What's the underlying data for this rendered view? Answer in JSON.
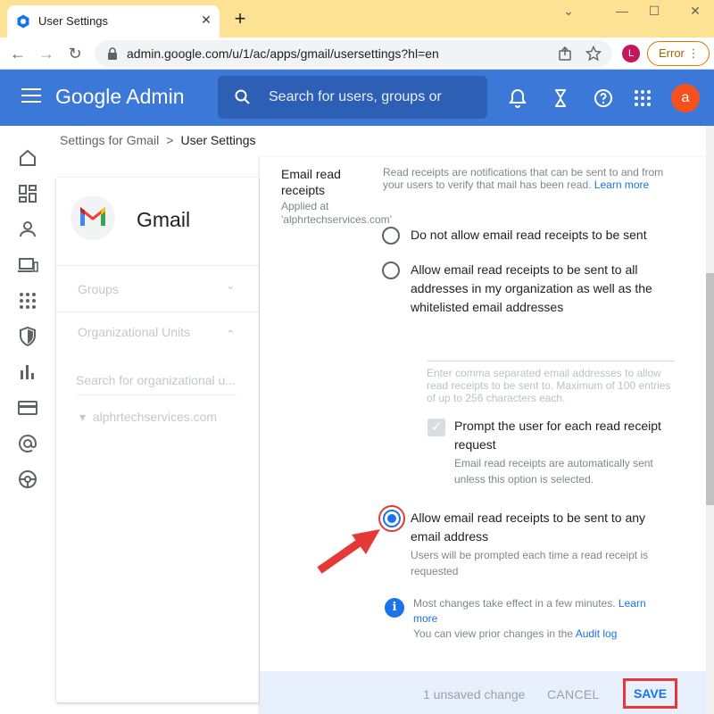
{
  "browser": {
    "tab_title": "User Settings",
    "tab_close": "✕",
    "new_tab": "+",
    "url": "admin.google.com/u/1/ac/apps/gmail/usersettings?hl=en",
    "profile_initial": "L",
    "error_label": "Error",
    "controls": {
      "minimize": "—",
      "maximize": "☐",
      "close": "✕"
    }
  },
  "header": {
    "brand": "Google Admin",
    "search_placeholder": "Search for users, groups or",
    "avatar_initial": "a"
  },
  "breadcrumb": {
    "parent": "Settings for Gmail",
    "separator": ">",
    "current": "User Settings"
  },
  "left_card": {
    "app_name": "Gmail",
    "groups_label": "Groups",
    "org_units_label": "Organizational Units",
    "ou_search_placeholder": "Search for organizational u...",
    "ou_item": "alphrtechservices.com",
    "chev_down": "⌄",
    "chev_up": "⌃",
    "caret": "▾"
  },
  "setting": {
    "title": "Email read receipts",
    "applied_at": "Applied at 'alphrtechservices.com'",
    "description": "Read receipts are notifications that can be sent to and from your users to verify that mail has been read.",
    "learn_more": "Learn more",
    "options": [
      {
        "label": "Do not allow email read receipts to be sent",
        "selected": false
      },
      {
        "label": "Allow email read receipts to be sent to all addresses in my organization as well as the whitelisted email addresses",
        "selected": false
      },
      {
        "label": "Allow email read receipts to be sent to any email address",
        "selected": true,
        "sub": "Users will be prompted each time a read receipt is requested"
      }
    ],
    "whitelist_placeholder": "Enter comma separated email addresses to allow read receipts to be sent to. Maximum of 100 entries of up to 256 characters each.",
    "prompt_checkbox": {
      "label": "Prompt the user for each read receipt request",
      "sub": "Email read receipts are automatically sent unless this option is selected.",
      "checked": true
    },
    "info_line1": "Most changes take effect in a few minutes.",
    "info_learn_more": "Learn more",
    "info_line2": "You can view prior changes in the",
    "audit_log": "Audit log"
  },
  "footer": {
    "unsaved": "1 unsaved change",
    "cancel": "CANCEL",
    "save": "SAVE"
  },
  "colors": {
    "header_blue": "#3c78d8",
    "accent_blue": "#1a73e8",
    "highlight_red": "#e53935",
    "tab_bar_yellow": "#fde293"
  }
}
